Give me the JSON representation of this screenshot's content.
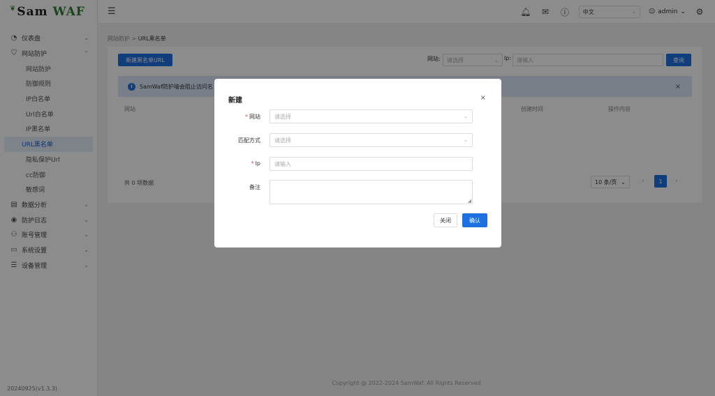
{
  "app": {
    "logo_main": "Sam",
    "logo_accent": "WAF",
    "version": "20240925(v1.3.3)"
  },
  "colors": {
    "primary": "#1e6fe0",
    "brand_green": "#2e7d32",
    "required": "#e34d59"
  },
  "sidebar": {
    "items": [
      {
        "label": "仪表盘",
        "icon": "dashboard-icon",
        "arrow": "⌄"
      },
      {
        "label": "网站防护",
        "icon": "shield-icon",
        "arrow": "⌃"
      },
      {
        "label": "数据分析",
        "icon": "chart-icon",
        "arrow": "⌄"
      },
      {
        "label": "防护日志",
        "icon": "log-icon",
        "arrow": "⌄"
      },
      {
        "label": "账号管理",
        "icon": "account-icon",
        "arrow": "⌄"
      },
      {
        "label": "系统设置",
        "icon": "settings-icon",
        "arrow": "⌄"
      },
      {
        "label": "设备管理",
        "icon": "device-icon",
        "arrow": "⌄"
      }
    ],
    "sub_items": [
      "网站防护",
      "防御规则",
      "IP白名单",
      "Url白名单",
      "IP黑名单",
      "URL黑名单",
      "隐私保护Url",
      "cc防御",
      "敏感词"
    ],
    "active_sub": "URL黑名单"
  },
  "header": {
    "language": "中文",
    "user": "admin"
  },
  "breadcrumb": {
    "parent": "网站防护",
    "separator": ">",
    "current": "URL黑名单"
  },
  "toolbar": {
    "add_label": "新建黑名单URL",
    "website_label": "网站:",
    "website_placeholder": "请选择",
    "ip_label": "Ip:",
    "ip_placeholder": "请输入",
    "query_label": "查询"
  },
  "alert": {
    "text": "SamWaf防护墙会阻止访问名"
  },
  "table": {
    "columns": [
      "网站",
      "创建时间",
      "操作内容"
    ]
  },
  "pagination": {
    "total_text": "共 0 项数据",
    "page_size": "10 条/页",
    "current_page": "1",
    "prev": "‹",
    "next": "›"
  },
  "footer": {
    "copyright": "Copyright @ 2022-2024 SamWaf. All Rights Reserved"
  },
  "modal": {
    "title": "新建",
    "close": "×",
    "fields": {
      "website": {
        "label": "网站",
        "placeholder": "请选择",
        "required": true
      },
      "match": {
        "label": "匹配方式",
        "placeholder": "请选择",
        "required": false
      },
      "ip": {
        "label": "Ip",
        "placeholder": "请输入",
        "required": true
      },
      "remark": {
        "label": "备注",
        "value": "",
        "required": false
      }
    },
    "cancel_label": "关闭",
    "confirm_label": "确认"
  }
}
